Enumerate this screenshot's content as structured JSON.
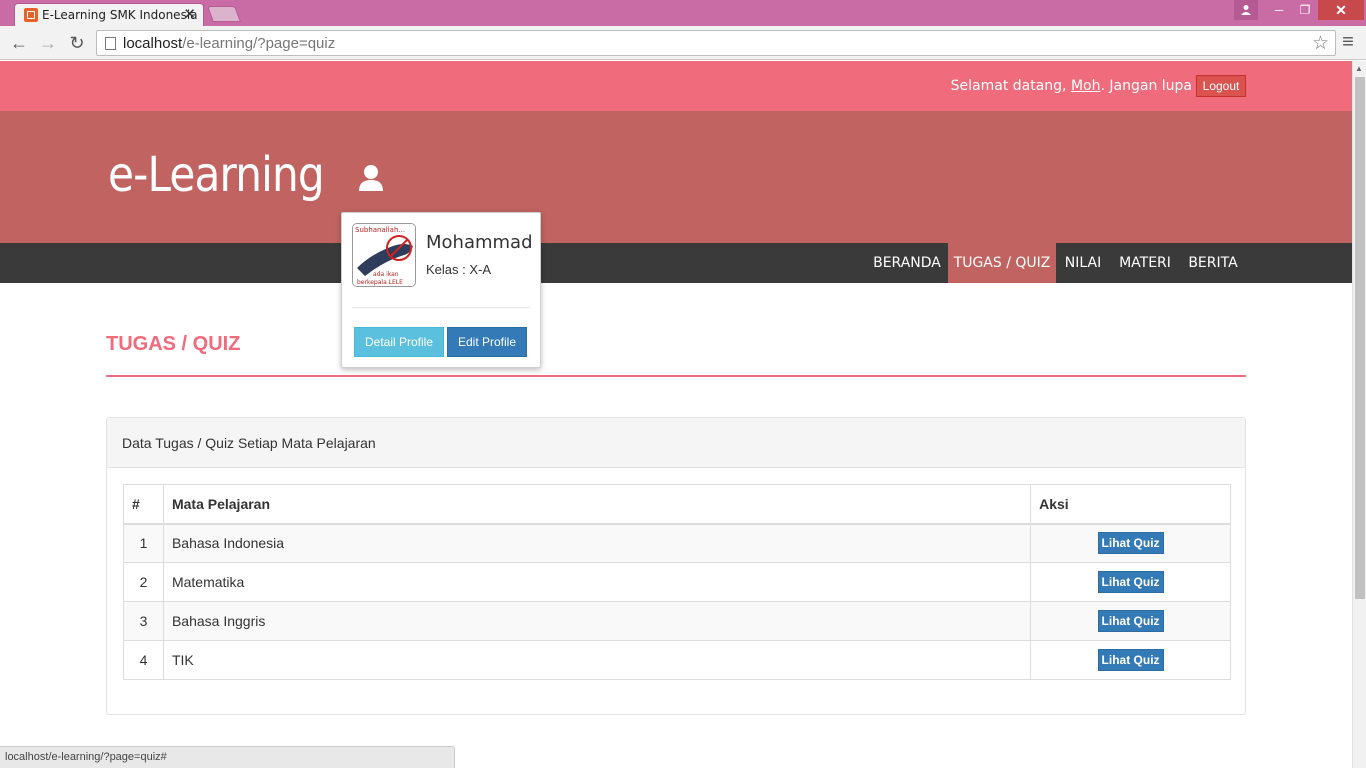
{
  "browser": {
    "tab_title": "E-Learning SMK Indonesia",
    "tab_close": "✕",
    "url_host": "localhost",
    "url_path": "/e-learning/?page=quiz",
    "status_url": "localhost/e-learning/?page=quiz#"
  },
  "header": {
    "welcome_prefix": "Selamat datang,",
    "welcome_user": "Moh",
    "welcome_suffix": ". Jangan lupa",
    "logout_label": "Logout",
    "brand": "e-Learning"
  },
  "nav": {
    "items": [
      {
        "label": "BERANDA"
      },
      {
        "label": "TUGAS / QUIZ"
      },
      {
        "label": "NILAI"
      },
      {
        "label": "MATERI"
      },
      {
        "label": "BERITA"
      }
    ],
    "active_index": 1
  },
  "popover": {
    "name": "Mohammad",
    "class": "Kelas : X-A",
    "detail_button": "Detail Profile",
    "edit_button": "Edit Profile",
    "avatar_caption_top": "Subhanallah...",
    "avatar_caption_bottom1": "ada ikan",
    "avatar_caption_bottom2": "berkepala LELE"
  },
  "main": {
    "section_title": "TUGAS / QUIZ",
    "panel_heading": "Data Tugas / Quiz Setiap Mata Pelajaran",
    "table": {
      "headers": [
        "#",
        "Mata Pelajaran",
        "Aksi"
      ],
      "rows": [
        {
          "no": "1",
          "subject": "Bahasa Indonesia",
          "action": "Lihat Quiz"
        },
        {
          "no": "2",
          "subject": "Matematika",
          "action": "Lihat Quiz"
        },
        {
          "no": "3",
          "subject": "Bahasa Inggris",
          "action": "Lihat Quiz"
        },
        {
          "no": "4",
          "subject": "TIK",
          "action": "Lihat Quiz"
        }
      ]
    }
  },
  "colors": {
    "topbar": "#f06b7b",
    "hero": "#c06361",
    "navbar": "#3a3a3a",
    "primary": "#337ab7",
    "info": "#5bc0de",
    "danger": "#d9534f"
  }
}
